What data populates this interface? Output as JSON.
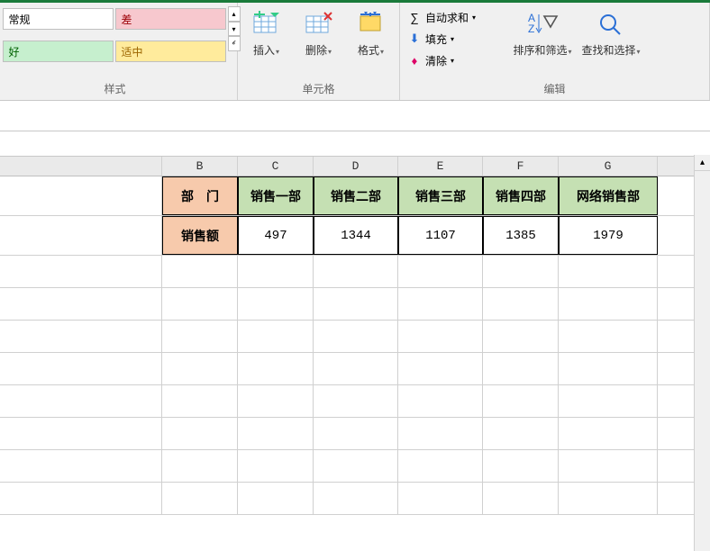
{
  "ribbon": {
    "styles": {
      "normal": "常规",
      "bad": "差",
      "good": "好",
      "neutral": "适中",
      "group_label": "样式"
    },
    "cells": {
      "insert": "插入",
      "delete": "删除",
      "format": "格式",
      "group_label": "单元格"
    },
    "editing": {
      "autosum": "自动求和",
      "fill": "填充",
      "clear": "清除",
      "sort_filter": "排序和筛选",
      "find_select": "查找和选择",
      "group_label": "编辑"
    }
  },
  "columns": [
    "B",
    "C",
    "D",
    "E",
    "F",
    "G"
  ],
  "data": {
    "row1_label": "部　门",
    "row1": [
      "销售一部",
      "销售二部",
      "销售三部",
      "销售四部",
      "网络销售部"
    ],
    "row2_label": "销售额",
    "row2": [
      "497",
      "1344",
      "1107",
      "1385",
      "1979"
    ]
  },
  "chart_data": {
    "type": "table",
    "title": "",
    "categories": [
      "销售一部",
      "销售二部",
      "销售三部",
      "销售四部",
      "网络销售部"
    ],
    "series": [
      {
        "name": "销售额",
        "values": [
          497,
          1344,
          1107,
          1385,
          1979
        ]
      }
    ]
  }
}
